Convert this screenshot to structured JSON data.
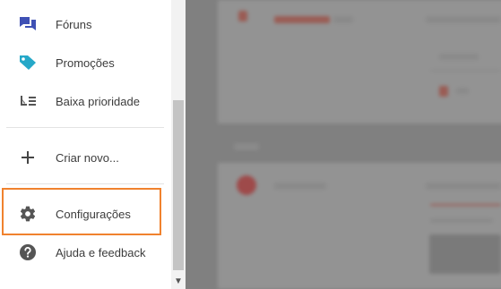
{
  "menu": {
    "forums": {
      "label": "Fóruns",
      "icon": "forum-icon",
      "color": "#3f51b5"
    },
    "promotions": {
      "label": "Promoções",
      "icon": "tag-icon",
      "color": "#26a8c8"
    },
    "low_priority": {
      "label": "Baixa prioridade",
      "icon": "low-priority-icon"
    },
    "create_new": {
      "label": "Criar novo...",
      "icon": "plus-icon"
    },
    "settings": {
      "label": "Configurações",
      "icon": "gear-icon"
    },
    "help": {
      "label": "Ajuda e feedback",
      "icon": "help-icon"
    }
  },
  "highlight_color": "#f0822e"
}
